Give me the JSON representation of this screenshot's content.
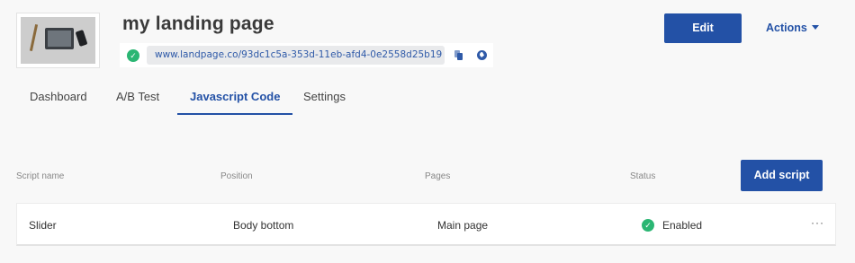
{
  "page": {
    "title": "my landing page",
    "url": "www.landpage.co/93dc1c5a-353d-11eb-afd4-0e2558d25b19"
  },
  "header": {
    "edit_label": "Edit",
    "actions_label": "Actions"
  },
  "tabs": [
    {
      "label": "Dashboard",
      "active": false
    },
    {
      "label": "A/B Test",
      "active": false
    },
    {
      "label": "Javascript Code",
      "active": true
    },
    {
      "label": "Settings",
      "active": false
    }
  ],
  "table": {
    "columns": [
      "Script name",
      "Position",
      "Pages",
      "Status"
    ],
    "add_label": "Add script",
    "rows": [
      {
        "name": "Slider",
        "position": "Body bottom",
        "pages": "Main page",
        "status": "Enabled",
        "more": "···"
      }
    ]
  },
  "icons": {
    "published": "check-circle-icon",
    "copy": "copy-icon",
    "open": "globe-icon",
    "status": "check-circle-icon",
    "menu": "more-horizontal-icon"
  },
  "colors": {
    "accent": "#2351a6",
    "success": "#2bb673",
    "link": "#2f5aa8",
    "background": "#f8f8f8"
  }
}
